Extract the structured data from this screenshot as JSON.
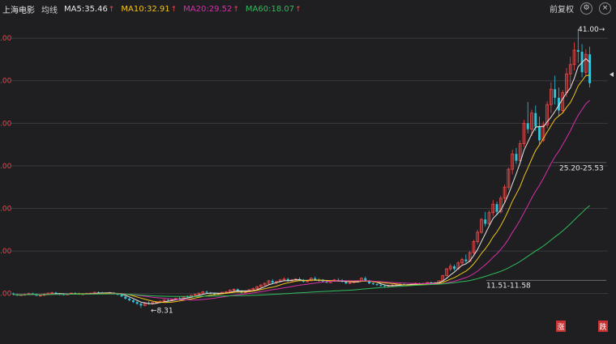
{
  "header": {
    "stock_name": "上海电影",
    "avg_line_label": "均线",
    "ma5": {
      "label": "MA5:",
      "value": "35.46",
      "color": "#e6e6e6"
    },
    "ma10": {
      "label": "MA10:",
      "value": "32.91",
      "color": "#f0c419"
    },
    "ma20": {
      "label": "MA20:",
      "value": "29.52",
      "color": "#d62fa8"
    },
    "ma60": {
      "label": "MA60:",
      "value": "18.07",
      "color": "#2fbd5a"
    },
    "arrow": "↑",
    "adjust_label": "前复权",
    "settings_icon": "⚙",
    "close_icon": "×"
  },
  "colors": {
    "up": "#f04848",
    "down": "#33c1d6",
    "grid_major": "#3a3a3f",
    "bg": "#1f1f22",
    "axis_text": "#f04848"
  },
  "annotations": {
    "high_label": "41.00→",
    "mid_label": "25.20-25.53",
    "low_label": "11.51-11.58",
    "min_label": "←8.31"
  },
  "markers": {
    "zhang": "涨",
    "die": "跌"
  },
  "chart_data": {
    "type": "candlestick",
    "title": "",
    "y_ticks": [
      {
        "label": ".00",
        "value": 40
      },
      {
        "label": ".00",
        "value": 35
      },
      {
        "label": ".00",
        "value": 30
      },
      {
        "label": ".00",
        "value": 25
      },
      {
        "label": ".00",
        "value": 20
      },
      {
        "label": ".00",
        "value": 15
      },
      {
        "label": ".00",
        "value": 10
      }
    ],
    "ylim": [
      5.5,
      42.2
    ],
    "candle_count": 150,
    "series": [
      {
        "name": "MA5",
        "color": "#e6e6e6"
      },
      {
        "name": "MA10",
        "color": "#f0c419"
      },
      {
        "name": "MA20",
        "color": "#d62fa8"
      },
      {
        "name": "MA60",
        "color": "#2fbd5a"
      }
    ],
    "candles": [
      [
        10.0,
        10.1,
        9.8,
        9.9
      ],
      [
        9.9,
        10.0,
        9.7,
        9.8
      ],
      [
        9.8,
        9.9,
        9.7,
        9.85
      ],
      [
        9.85,
        10.0,
        9.75,
        9.9
      ],
      [
        9.9,
        10.1,
        9.8,
        10.0
      ],
      [
        10.0,
        10.1,
        9.85,
        9.9
      ],
      [
        9.9,
        10.0,
        9.7,
        9.75
      ],
      [
        9.75,
        9.9,
        9.6,
        9.8
      ],
      [
        9.8,
        10.0,
        9.7,
        9.95
      ],
      [
        9.95,
        10.1,
        9.85,
        10.05
      ],
      [
        10.05,
        10.2,
        9.95,
        10.1
      ],
      [
        10.1,
        10.2,
        9.9,
        9.95
      ],
      [
        9.95,
        10.05,
        9.8,
        9.9
      ],
      [
        9.9,
        10.0,
        9.75,
        9.85
      ],
      [
        9.85,
        10.0,
        9.8,
        9.95
      ],
      [
        9.95,
        10.1,
        9.9,
        10.05
      ],
      [
        10.05,
        10.15,
        9.95,
        10.0
      ],
      [
        10.0,
        10.1,
        9.85,
        9.9
      ],
      [
        9.9,
        10.0,
        9.8,
        9.95
      ],
      [
        9.95,
        10.1,
        9.9,
        10.0
      ],
      [
        10.0,
        10.1,
        9.9,
        10.05
      ],
      [
        10.05,
        10.2,
        10.0,
        10.15
      ],
      [
        10.15,
        10.25,
        10.05,
        10.1
      ],
      [
        10.1,
        10.2,
        9.95,
        10.0
      ],
      [
        10.0,
        10.1,
        9.9,
        10.05
      ],
      [
        10.05,
        10.2,
        10.0,
        10.1
      ],
      [
        10.1,
        10.15,
        9.9,
        9.95
      ],
      [
        9.95,
        10.05,
        9.8,
        9.85
      ],
      [
        9.85,
        9.95,
        9.6,
        9.65
      ],
      [
        9.65,
        9.7,
        9.3,
        9.4
      ],
      [
        9.4,
        9.5,
        9.1,
        9.2
      ],
      [
        9.2,
        9.3,
        8.9,
        9.0
      ],
      [
        9.0,
        9.1,
        8.7,
        8.8
      ],
      [
        8.8,
        8.95,
        8.31,
        8.6
      ],
      [
        8.6,
        9.0,
        8.5,
        8.9
      ],
      [
        8.9,
        9.1,
        8.7,
        8.8
      ],
      [
        8.8,
        9.0,
        8.7,
        8.95
      ],
      [
        8.95,
        9.1,
        8.8,
        9.0
      ],
      [
        9.0,
        9.2,
        8.9,
        9.1
      ],
      [
        9.1,
        9.3,
        9.0,
        9.25
      ],
      [
        9.25,
        9.4,
        9.1,
        9.2
      ],
      [
        9.2,
        9.35,
        9.05,
        9.3
      ],
      [
        9.3,
        9.5,
        9.2,
        9.45
      ],
      [
        9.45,
        9.6,
        9.3,
        9.4
      ],
      [
        9.4,
        9.7,
        9.35,
        9.65
      ],
      [
        9.65,
        9.8,
        9.5,
        9.6
      ],
      [
        9.6,
        9.85,
        9.55,
        9.8
      ],
      [
        9.8,
        10.0,
        9.7,
        9.9
      ],
      [
        9.9,
        10.1,
        9.8,
        10.05
      ],
      [
        10.05,
        10.3,
        10.0,
        10.2
      ],
      [
        10.2,
        10.35,
        10.05,
        10.1
      ],
      [
        10.1,
        10.2,
        9.9,
        10.0
      ],
      [
        10.0,
        10.1,
        9.8,
        9.9
      ],
      [
        9.9,
        10.05,
        9.8,
        10.0
      ],
      [
        10.0,
        10.2,
        9.95,
        10.15
      ],
      [
        10.15,
        10.3,
        10.0,
        10.2
      ],
      [
        10.2,
        10.5,
        10.15,
        10.4
      ],
      [
        10.4,
        10.6,
        10.3,
        10.5
      ],
      [
        10.5,
        10.6,
        10.2,
        10.3
      ],
      [
        10.3,
        10.4,
        10.0,
        10.1
      ],
      [
        10.1,
        10.3,
        10.0,
        10.25
      ],
      [
        10.25,
        10.5,
        10.2,
        10.45
      ],
      [
        10.45,
        10.7,
        10.4,
        10.6
      ],
      [
        10.6,
        10.9,
        10.5,
        10.8
      ],
      [
        10.8,
        11.1,
        10.7,
        11.0
      ],
      [
        11.0,
        11.3,
        10.9,
        11.2
      ],
      [
        11.2,
        11.6,
        11.1,
        11.5
      ],
      [
        11.5,
        11.7,
        11.2,
        11.3
      ],
      [
        11.3,
        11.5,
        11.1,
        11.4
      ],
      [
        11.4,
        11.7,
        11.3,
        11.6
      ],
      [
        11.6,
        11.9,
        11.5,
        11.7
      ],
      [
        11.7,
        11.85,
        11.4,
        11.5
      ],
      [
        11.5,
        11.7,
        11.3,
        11.6
      ],
      [
        11.6,
        11.8,
        11.45,
        11.7
      ],
      [
        11.7,
        11.9,
        11.5,
        11.55
      ],
      [
        11.55,
        11.7,
        11.3,
        11.4
      ],
      [
        11.4,
        11.6,
        11.3,
        11.5
      ],
      [
        11.5,
        11.9,
        11.45,
        11.8
      ],
      [
        11.8,
        12.0,
        11.5,
        11.6
      ],
      [
        11.6,
        11.8,
        11.4,
        11.5
      ],
      [
        11.5,
        11.7,
        11.3,
        11.45
      ],
      [
        11.45,
        11.6,
        11.2,
        11.3
      ],
      [
        11.3,
        11.5,
        11.2,
        11.45
      ],
      [
        11.45,
        11.7,
        11.4,
        11.6
      ],
      [
        11.6,
        11.8,
        11.4,
        11.5
      ],
      [
        11.5,
        11.7,
        11.3,
        11.4
      ],
      [
        11.4,
        11.5,
        11.1,
        11.2
      ],
      [
        11.2,
        11.4,
        11.1,
        11.3
      ],
      [
        11.3,
        11.5,
        11.2,
        11.4
      ],
      [
        11.4,
        11.6,
        11.3,
        11.5
      ],
      [
        11.5,
        11.9,
        11.4,
        11.8
      ],
      [
        11.8,
        12.0,
        11.4,
        11.5
      ],
      [
        11.5,
        11.6,
        11.1,
        11.2
      ],
      [
        11.2,
        11.3,
        11.0,
        11.1
      ],
      [
        11.1,
        11.2,
        10.9,
        11.0
      ],
      [
        11.0,
        11.1,
        10.8,
        10.9
      ],
      [
        10.9,
        11.0,
        10.7,
        10.85
      ],
      [
        10.85,
        11.0,
        10.7,
        10.9
      ],
      [
        10.9,
        11.1,
        10.8,
        11.0
      ],
      [
        11.0,
        11.15,
        10.9,
        11.05
      ],
      [
        11.05,
        11.2,
        10.95,
        11.1
      ],
      [
        11.1,
        11.2,
        10.95,
        11.0
      ],
      [
        11.0,
        11.1,
        10.9,
        11.05
      ],
      [
        11.05,
        11.2,
        11.0,
        11.15
      ],
      [
        11.15,
        11.3,
        11.05,
        11.2
      ],
      [
        11.2,
        11.3,
        11.05,
        11.1
      ],
      [
        11.1,
        11.25,
        11.0,
        11.2
      ],
      [
        11.2,
        11.35,
        11.1,
        11.3
      ],
      [
        11.3,
        11.4,
        11.15,
        11.2
      ],
      [
        11.2,
        11.35,
        11.1,
        11.25
      ],
      [
        11.25,
        11.55,
        11.51,
        11.5
      ],
      [
        11.5,
        12.2,
        11.45,
        12.1
      ],
      [
        12.1,
        13.0,
        12.0,
        12.9
      ],
      [
        12.9,
        13.5,
        12.6,
        13.2
      ],
      [
        13.2,
        13.4,
        12.7,
        12.9
      ],
      [
        12.9,
        13.8,
        12.8,
        13.6
      ],
      [
        13.6,
        14.2,
        13.3,
        14.0
      ],
      [
        14.0,
        14.6,
        13.6,
        13.8
      ],
      [
        13.8,
        15.0,
        13.7,
        14.8
      ],
      [
        14.8,
        16.3,
        14.6,
        16.1
      ],
      [
        16.1,
        17.5,
        15.8,
        17.2
      ],
      [
        17.2,
        18.9,
        17.0,
        18.7
      ],
      [
        18.7,
        19.6,
        17.9,
        18.2
      ],
      [
        18.2,
        19.8,
        18.0,
        19.5
      ],
      [
        19.5,
        21.0,
        19.1,
        20.5
      ],
      [
        20.5,
        20.8,
        19.2,
        19.6
      ],
      [
        19.6,
        21.5,
        19.4,
        21.2
      ],
      [
        21.2,
        22.8,
        20.7,
        22.5
      ],
      [
        22.5,
        24.8,
        22.2,
        24.6
      ],
      [
        24.6,
        26.9,
        24.0,
        26.4
      ],
      [
        26.4,
        27.1,
        25.2,
        25.6
      ],
      [
        25.6,
        28.0,
        25.3,
        27.6
      ],
      [
        27.6,
        30.4,
        27.2,
        30.0
      ],
      [
        30.0,
        32.5,
        28.8,
        29.3
      ],
      [
        29.3,
        31.6,
        28.5,
        31.2
      ],
      [
        31.2,
        32.1,
        29.1,
        29.6
      ],
      [
        29.6,
        30.8,
        27.5,
        28.0
      ],
      [
        28.0,
        30.2,
        27.8,
        29.8
      ],
      [
        29.8,
        32.6,
        29.4,
        32.2
      ],
      [
        32.2,
        34.8,
        31.2,
        34.0
      ],
      [
        34.0,
        35.6,
        32.2,
        33.0
      ],
      [
        33.0,
        34.2,
        30.8,
        31.5
      ],
      [
        31.5,
        33.9,
        31.2,
        33.6
      ],
      [
        33.6,
        36.5,
        33.1,
        35.8
      ],
      [
        35.8,
        37.8,
        34.4,
        36.9
      ],
      [
        36.9,
        39.5,
        36.2,
        38.6
      ],
      [
        38.6,
        41.0,
        37.1,
        38.4
      ],
      [
        38.4,
        39.3,
        35.4,
        36.0
      ],
      [
        36.0,
        38.7,
        35.6,
        38.1
      ],
      [
        38.1,
        39.0,
        34.2,
        34.7
      ]
    ]
  }
}
